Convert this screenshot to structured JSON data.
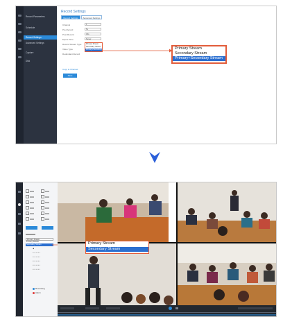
{
  "top_screen": {
    "page_title": "Record Settings",
    "tabs": [
      {
        "label": "Record Settings",
        "active": true
      },
      {
        "label": "Advanced Settings",
        "active": false
      }
    ],
    "menu_items": [
      "Record Parameters",
      "Schedule",
      "Record Settings",
      "Advanced Settings",
      "Capture",
      "Disk"
    ],
    "fields": [
      {
        "label": "Channel",
        "value": "1"
      },
      {
        "label": "Pre-Record",
        "value": "5s"
      },
      {
        "label": "Post-Record",
        "value": "30s"
      },
      {
        "label": "Expire Time",
        "value": "Never"
      },
      {
        "label": "Record Stream Type",
        "value": "Primary Stream"
      },
      {
        "label": "Video Type",
        "value": ""
      },
      {
        "label": "Redundant Record",
        "value": ""
      }
    ],
    "link_text": "Copy to Channel",
    "save_label": "Save",
    "dropdown_options": [
      "Primary Stream",
      "Secondary Stream",
      "Primary+Secondary Stream"
    ],
    "dropdown_selected_index": 2
  },
  "arrow_color": "#2b5fd9",
  "accent_color": "#e25c3a",
  "selection_color": "#2b6fd0",
  "bottom_screen": {
    "stream_dropdown_current": "Primary Stream",
    "stream_dropdown_options": [
      "Primary Stream",
      "Secondary Stream"
    ],
    "stream_dropdown_selected_index": 1,
    "legend": [
      {
        "label": "Recording",
        "color": "#2b8ad9"
      },
      {
        "label": "Alarm",
        "color": "#e03a3a"
      }
    ],
    "video_tiles": 4
  }
}
